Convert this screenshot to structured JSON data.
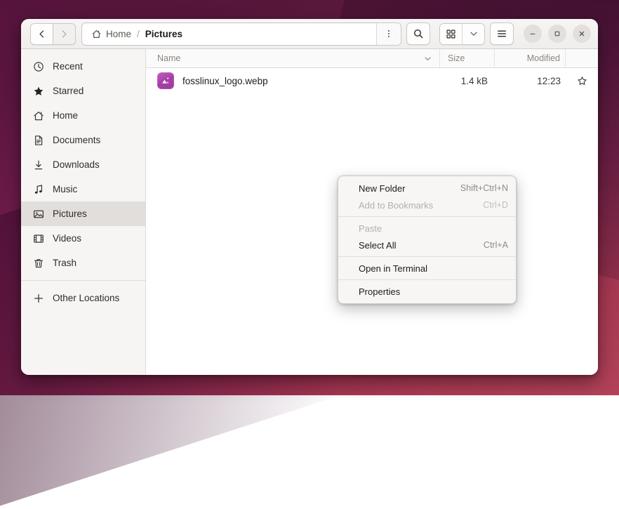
{
  "window": {
    "title": "Pictures",
    "nav": {
      "back_label": "Back",
      "forward_label": "Forward",
      "back_icon": "chevron-left-icon",
      "forward_icon": "chevron-right-icon"
    },
    "pathbar": {
      "home_icon": "home-icon",
      "crumbs": [
        {
          "label": "Home",
          "current": false
        },
        {
          "label": "Pictures",
          "current": true
        }
      ],
      "separator": "/",
      "menu_icon": "vertical-dots-icon"
    },
    "search_icon": "search-icon",
    "view": {
      "grid_icon": "grid-view-icon",
      "dropdown_icon": "chevron-down-icon",
      "hamburger_icon": "hamburger-menu-icon"
    },
    "controls": {
      "minimize": "minimize-icon",
      "maximize": "maximize-icon",
      "close": "close-icon"
    }
  },
  "sidebar": {
    "items": [
      {
        "label": "Recent",
        "icon": "clock-icon",
        "selected": false
      },
      {
        "label": "Starred",
        "icon": "star-icon",
        "selected": false
      },
      {
        "label": "Home",
        "icon": "home-icon",
        "selected": false
      },
      {
        "label": "Documents",
        "icon": "document-icon",
        "selected": false
      },
      {
        "label": "Downloads",
        "icon": "download-icon",
        "selected": false
      },
      {
        "label": "Music",
        "icon": "music-icon",
        "selected": false
      },
      {
        "label": "Pictures",
        "icon": "picture-icon",
        "selected": true
      },
      {
        "label": "Videos",
        "icon": "video-icon",
        "selected": false
      },
      {
        "label": "Trash",
        "icon": "trash-icon",
        "selected": false
      },
      {
        "label": "Other Locations",
        "icon": "plus-icon",
        "selected": false
      }
    ]
  },
  "filelist": {
    "columns": {
      "name": "Name",
      "size": "Size",
      "modified": "Modified",
      "sort_icon": "chevron-down-icon"
    },
    "rows": [
      {
        "name": "fosslinux_logo.webp",
        "size": "1.4 kB",
        "modified": "12:23",
        "icon": "image-file-icon",
        "star_icon": "star-outline-icon",
        "icon_color": "#a83fa8"
      }
    ]
  },
  "context_menu": {
    "items": [
      {
        "label": "New Folder",
        "accel": "Shift+Ctrl+N",
        "disabled": false,
        "sep_after": false
      },
      {
        "label": "Add to Bookmarks",
        "accel": "Ctrl+D",
        "disabled": true,
        "sep_after": true
      },
      {
        "label": "Paste",
        "accel": "",
        "disabled": true,
        "sep_after": false
      },
      {
        "label": "Select All",
        "accel": "Ctrl+A",
        "disabled": false,
        "sep_after": true
      },
      {
        "label": "Open in Terminal",
        "accel": "",
        "disabled": false,
        "sep_after": true
      },
      {
        "label": "Properties",
        "accel": "",
        "disabled": false,
        "sep_after": false
      }
    ]
  },
  "colors": {
    "accent": "#a83fa8",
    "selection": "#e2dedb",
    "window_bg": "#ffffff",
    "sidebar_bg": "#f7f5f4",
    "header_bg": "#f3f1ef",
    "wallpaper": "#6d1f4c"
  }
}
